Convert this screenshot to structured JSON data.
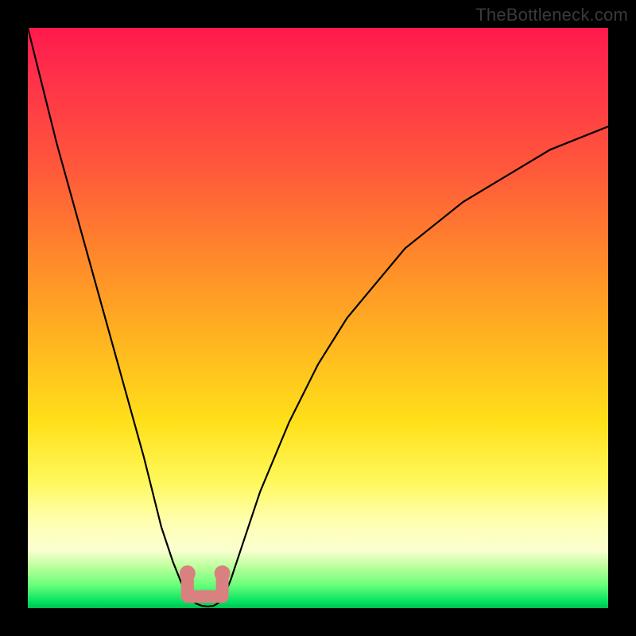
{
  "watermark": "TheBottleneck.com",
  "chart_data": {
    "type": "line",
    "title": "",
    "xlabel": "",
    "ylabel": "",
    "xlim": [
      0,
      100
    ],
    "ylim": [
      0,
      100
    ],
    "grid": false,
    "legend": false,
    "series": [
      {
        "name": "bottleneck-curve",
        "x": [
          0,
          5,
          10,
          15,
          20,
          23,
          25,
          27,
          28,
          29,
          30,
          31,
          32,
          33,
          34,
          35,
          37,
          40,
          45,
          50,
          55,
          60,
          65,
          70,
          75,
          80,
          85,
          90,
          95,
          100
        ],
        "y": [
          100,
          80,
          62,
          44,
          26,
          14,
          8,
          3,
          1.5,
          0.8,
          0.4,
          0.3,
          0.4,
          1,
          2.5,
          5,
          11,
          20,
          32,
          42,
          50,
          56,
          62,
          66,
          70,
          73,
          76,
          79,
          81,
          83
        ]
      }
    ],
    "annotations": [
      {
        "name": "valley-marker",
        "shape": "u-bracket",
        "x_range": [
          27.5,
          33.5
        ],
        "y": 2,
        "color": "#d98080"
      }
    ],
    "background_gradient": {
      "top": "#ff1a4d",
      "mid": "#ffd21a",
      "bottom": "#00c050"
    }
  }
}
